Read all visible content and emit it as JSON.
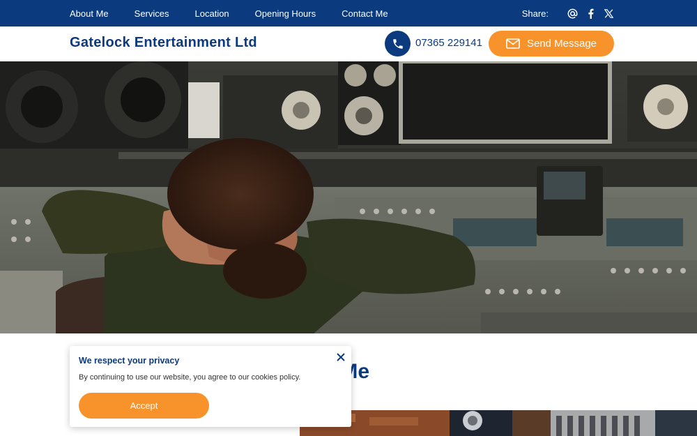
{
  "nav": {
    "items": [
      "About Me",
      "Services",
      "Location",
      "Opening Hours",
      "Contact Me"
    ],
    "share_label": "Share:",
    "share_icons": [
      "at-icon",
      "facebook-icon",
      "x-icon"
    ]
  },
  "header": {
    "brand": "Gatelock Entertainment Ltd",
    "phone": "07365 229141",
    "send_label": "Send Message"
  },
  "about": {
    "title": "About Me",
    "title_visible": "t Me"
  },
  "cookie": {
    "title": "We respect your privacy",
    "text": "By continuing to use our website, you agree to our cookies policy.",
    "accept_label": "Accept"
  },
  "colors": {
    "primary": "#0b3a7e",
    "accent": "#f7932a",
    "white": "#ffffff"
  }
}
